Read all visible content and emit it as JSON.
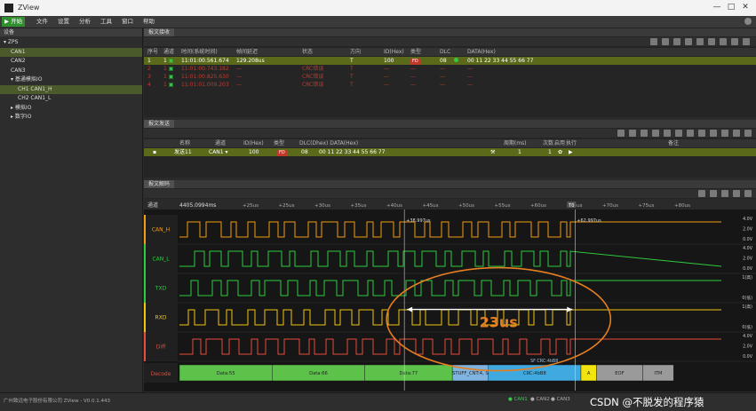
{
  "window": {
    "title": "ZView",
    "min": "—",
    "max": "□",
    "close": "✕"
  },
  "toolbar": {
    "start": "▶ 开始",
    "items": [
      "文件",
      "设置",
      "分析",
      "工具",
      "窗口",
      "帮助"
    ]
  },
  "device_panel": {
    "title": "设备",
    "items": [
      {
        "label": "▾ ZPS",
        "indent": 0,
        "selected": false
      },
      {
        "label": "CAN1",
        "indent": 1,
        "selected": true
      },
      {
        "label": "CAN2",
        "indent": 1,
        "selected": false
      },
      {
        "label": "CAN3",
        "indent": 1,
        "selected": false
      },
      {
        "label": "▾ 基通模拟IO",
        "indent": 1,
        "selected": false
      },
      {
        "label": "CH1 CAN1_H",
        "indent": 2,
        "selected": true
      },
      {
        "label": "CH2 CAN1_L",
        "indent": 2,
        "selected": false
      },
      {
        "label": "▸ 模拟IO",
        "indent": 1,
        "selected": false
      },
      {
        "label": "▸ 数字IO",
        "indent": 1,
        "selected": false
      }
    ]
  },
  "receive_panel": {
    "tab": "报文接收",
    "columns": [
      "序号",
      "通道",
      "时间(系统时间)",
      "帧间延迟",
      "状态",
      "方向",
      "ID(Hex)",
      "类型",
      "DLC",
      "DATA(Hex)"
    ],
    "rows": [
      {
        "no": "1",
        "ch": "1",
        "time": "11:01:00.561.674",
        "delay": "129.208us",
        "status": "",
        "dir": "T",
        "id": "100",
        "type": "FD",
        "dlc": "08",
        "data": "00 11 22 33 44 55 66 77",
        "style": "hl"
      },
      {
        "no": "2",
        "ch": "1",
        "time": "11:01:00.743.182",
        "delay": "—",
        "status": "CRC错误",
        "dir": "T",
        "id": "—",
        "type": "—",
        "dlc": "—",
        "data": "—",
        "style": "err"
      },
      {
        "no": "3",
        "ch": "1",
        "time": "11:01:00.825.630",
        "delay": "—",
        "status": "CRC错误",
        "dir": "T",
        "id": "—",
        "type": "—",
        "dlc": "—",
        "data": "—",
        "style": "err"
      },
      {
        "no": "4",
        "ch": "1",
        "time": "11:01:01.009.203",
        "delay": "—",
        "status": "CRC错误",
        "dir": "T",
        "id": "—",
        "type": "—",
        "dlc": "—",
        "data": "—",
        "style": "err"
      }
    ]
  },
  "send_panel": {
    "tab": "报文发送",
    "columns": [
      "名称",
      "通道",
      "ID(Hex)",
      "类型",
      "DLC(Dhex) DATA(Hex)",
      "周期(ms)",
      "次数",
      "启用",
      "执行",
      "备注"
    ],
    "row": {
      "name": "发送11",
      "ch": "CAN1 ▾",
      "id": "100",
      "type": "FD",
      "dlc": "08",
      "data": "00 11 22 33 44 55 66 77",
      "period": "1",
      "count": "1"
    }
  },
  "decode_panel": {
    "tab": "报文解码",
    "time_label": "通道",
    "time_origin": "4405.0994ms",
    "ticks": [
      "+25us",
      "+25us",
      "+30us",
      "+35us",
      "+40us",
      "+45us",
      "+50us",
      "+55us",
      "+60us",
      "+65us",
      "+70us",
      "+75us",
      "+80us"
    ],
    "cursor_a": "+38.997us",
    "cursor_b": "+62.997us",
    "cursor_tag": "T0",
    "channels": [
      {
        "name": "CAN_H",
        "color": "#f39c12",
        "scale": [
          "4.0V",
          "2.0V",
          "0.0V"
        ]
      },
      {
        "name": "CAN_L",
        "color": "#2ecc40",
        "scale": [
          "4.0V",
          "2.0V",
          "0.0V"
        ]
      },
      {
        "name": "TXD",
        "color": "#2ecc40",
        "scale": [
          "1(高)",
          "0(低)"
        ]
      },
      {
        "name": "RXD",
        "color": "#f1c40f",
        "scale": [
          "1(高)",
          "0(低)"
        ]
      },
      {
        "name": "Diff",
        "color": "#e74c3c",
        "scale": [
          "4.0V",
          "2.0V",
          "0.0V"
        ]
      }
    ],
    "decode_label": "Decode",
    "segments": [
      {
        "label": "Data:55",
        "color": "#5dc24a",
        "start": 0.0,
        "end": 0.18
      },
      {
        "label": "Data:66",
        "color": "#5dc24a",
        "start": 0.18,
        "end": 0.36
      },
      {
        "label": "Data:77",
        "color": "#5dc24a",
        "start": 0.36,
        "end": 0.53
      },
      {
        "label": "STUFF_CNT:4, S",
        "color": "#7fb3e0",
        "start": 0.53,
        "end": 0.6
      },
      {
        "label": "CRC:4bB8",
        "color": "#3fa9e0",
        "start": 0.6,
        "end": 0.78
      },
      {
        "label": "A",
        "color": "#f1e40f",
        "start": 0.78,
        "end": 0.81
      },
      {
        "label": "EOF",
        "color": "#9a9a9a",
        "start": 0.81,
        "end": 0.9
      },
      {
        "label": "ITM",
        "color": "#9a9a9a",
        "start": 0.9,
        "end": 0.96
      }
    ],
    "measure_label": "23us",
    "crc_tag": "SF CRC:4bB8"
  },
  "statusbar": {
    "left": "广州致远电子股份有限公司  ZView - V0.0.1.443",
    "can1": "CAN1",
    "can2": "CAN2",
    "can3": "CAN3"
  },
  "watermark": "CSDN @不脱发的程序猿"
}
